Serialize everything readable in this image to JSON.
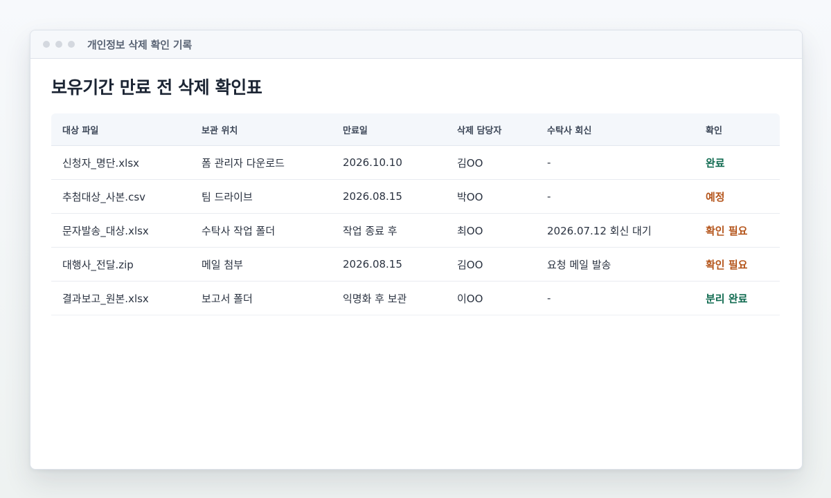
{
  "window": {
    "title": "개인정보 삭제 확인 기록"
  },
  "page": {
    "title": "보유기간 만료 전 삭제 확인표"
  },
  "table": {
    "headers": [
      "대상 파일",
      "보관 위치",
      "만료일",
      "삭제 담당자",
      "수탁사 회신",
      "확인"
    ],
    "rows": [
      [
        "신청자_명단.xlsx",
        "폼 관리자 다운로드",
        "2026.10.10",
        "김OO",
        "-",
        "완료"
      ],
      [
        "추첨대상_사본.csv",
        "팀 드라이브",
        "2026.08.15",
        "박OO",
        "-",
        "예정"
      ],
      [
        "문자발송_대상.xlsx",
        "수탁사 작업 폴더",
        "작업 종료 후",
        "최OO",
        "2026.07.12 회신 대기",
        "확인 필요"
      ],
      [
        "대행사_전달.zip",
        "메일 첨부",
        "2026.08.15",
        "김OO",
        "요청 메일 발송",
        "확인 필요"
      ],
      [
        "결과보고_원본.xlsx",
        "보고서 폴더",
        "익명화 후 보관",
        "이OO",
        "-",
        "분리 완료"
      ]
    ]
  },
  "colors": {
    "status_done": "#0f6a4f",
    "status_pending": "#b4541a"
  }
}
